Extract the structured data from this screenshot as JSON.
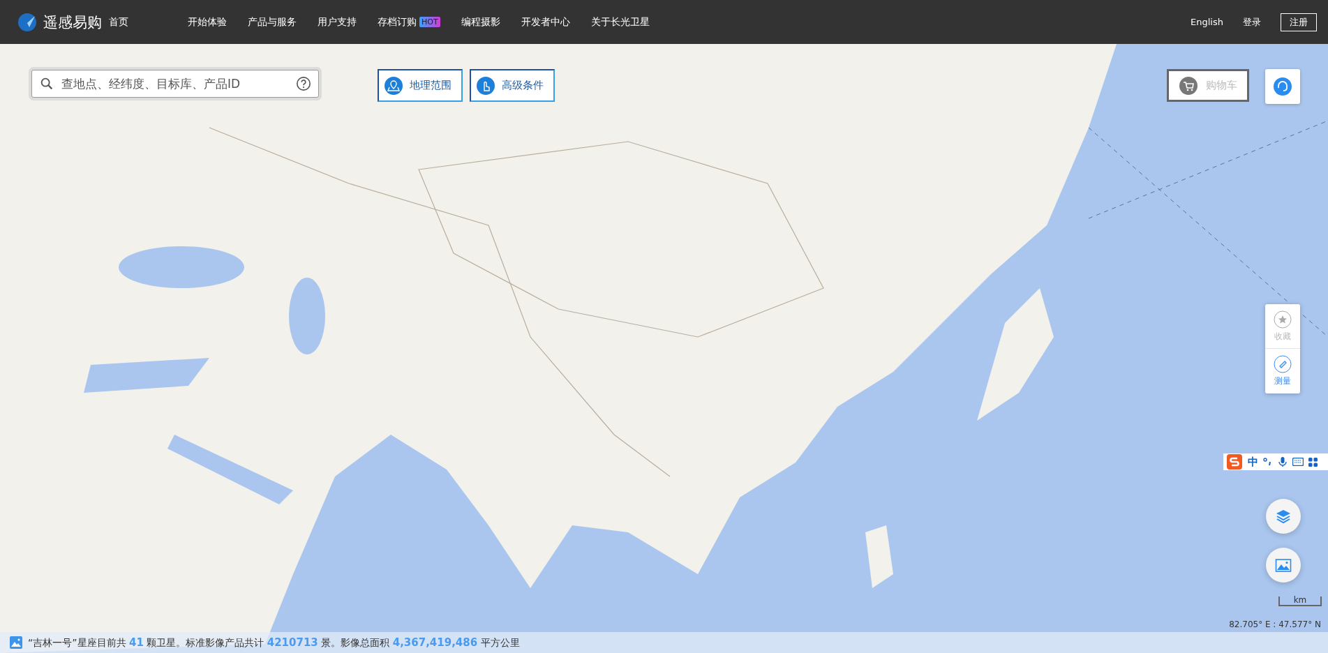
{
  "header": {
    "brand": "遥感易购",
    "home": "首页",
    "nav": [
      {
        "label": "开始体验"
      },
      {
        "label": "产品与服务"
      },
      {
        "label": "用户支持"
      },
      {
        "label": "存档订购",
        "badge": "HOT"
      },
      {
        "label": "编程摄影"
      },
      {
        "label": "开发者中心"
      },
      {
        "label": "关于长光卫星"
      }
    ],
    "language": "English",
    "login": "登录",
    "register": "注册"
  },
  "search": {
    "placeholder": "查地点、经纬度、目标库、产品ID"
  },
  "filters": [
    {
      "label": "地理范围",
      "kind": "map"
    },
    {
      "label": "高级条件",
      "kind": "tap"
    }
  ],
  "cart": {
    "label": "购物车",
    "disabled": true
  },
  "tools": [
    {
      "label": "收藏",
      "kind": "star",
      "selected": false
    },
    {
      "label": "测量",
      "kind": "ruler",
      "selected": true
    }
  ],
  "ime": {
    "mode": "中"
  },
  "scale": {
    "unit": "km"
  },
  "coordinates": "82.705° E : 47.577° N",
  "status": [
    {
      "text": "“吉林一号”星座目前共 ",
      "highlight": false
    },
    {
      "text": "41",
      "highlight": true
    },
    {
      "text": " 颗卫星。标准影像产品共计 ",
      "highlight": false
    },
    {
      "text": "4210713",
      "highlight": true
    },
    {
      "text": " 景。影像总面积 ",
      "highlight": false
    },
    {
      "text": "4,367,419,486",
      "highlight": true
    },
    {
      "text": " 平方公里",
      "highlight": false
    }
  ]
}
